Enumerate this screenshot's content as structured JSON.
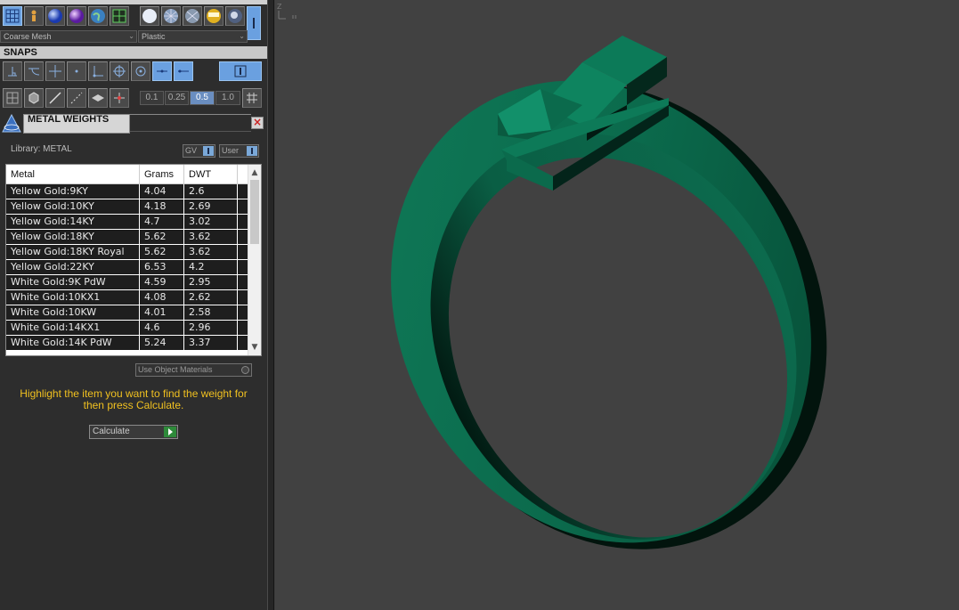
{
  "toolbar": {
    "mesh_dropdown": "Coarse Mesh",
    "material_dropdown": "Plastic"
  },
  "snaps": {
    "title": "SNAPS",
    "values": [
      "0.1",
      "0.25",
      "0.5",
      "1.0"
    ],
    "selected_value": "0.5"
  },
  "metal_weights": {
    "title": "METAL WEIGHTS",
    "library_label": "Library: METAL",
    "toggle_gv": "GV",
    "toggle_user": "User",
    "columns": [
      "Metal",
      "Grams",
      "DWT"
    ],
    "rows": [
      {
        "metal": "Yellow Gold:9KY",
        "grams": "4.04",
        "dwt": "2.6"
      },
      {
        "metal": "Yellow Gold:10KY",
        "grams": "4.18",
        "dwt": "2.69"
      },
      {
        "metal": "Yellow Gold:14KY",
        "grams": "4.7",
        "dwt": "3.02"
      },
      {
        "metal": "Yellow Gold:18KY",
        "grams": "5.62",
        "dwt": "3.62"
      },
      {
        "metal": "Yellow Gold:18KY Royal",
        "grams": "5.62",
        "dwt": "3.62"
      },
      {
        "metal": "Yellow Gold:22KY",
        "grams": "6.53",
        "dwt": "4.2"
      },
      {
        "metal": "White Gold:9K PdW",
        "grams": "4.59",
        "dwt": "2.95"
      },
      {
        "metal": "White Gold:10KX1",
        "grams": "4.08",
        "dwt": "2.62"
      },
      {
        "metal": "White Gold:10KW",
        "grams": "4.01",
        "dwt": "2.58"
      },
      {
        "metal": "White Gold:14KX1",
        "grams": "4.6",
        "dwt": "2.96"
      },
      {
        "metal": "White Gold:14K PdW",
        "grams": "5.24",
        "dwt": "3.37"
      }
    ],
    "use_object_materials": "Use Object Materials",
    "hint": "Highlight the item you want to find the weight for then press Calculate.",
    "calculate_label": "Calculate"
  },
  "colors": {
    "panel_bg": "#2d2d2d",
    "viewport_bg": "#414141",
    "ring_color": "#0d6b4f",
    "hint_color": "#f0c020",
    "accent_blue": "#6aa0e0"
  },
  "icons": {
    "top_row": [
      "grid-icon",
      "figure-icon",
      "blue-sphere-icon",
      "purple-sphere-icon",
      "globe-icon",
      "green-grid-icon"
    ],
    "render_row": [
      "white-sphere-icon",
      "wire-sphere-icon",
      "wire-sphere-alt-icon",
      "gold-sphere-icon",
      "chrome-sphere-icon"
    ],
    "snap_row": [
      "snap-perpendicular-icon",
      "snap-tangent-icon",
      "snap-intersection-icon",
      "snap-point-icon",
      "snap-corner-icon",
      "snap-center-icon",
      "snap-circle-icon",
      "snap-midpoint-icon",
      "snap-end-icon"
    ],
    "snap_row2": [
      "snap-grid-icon",
      "snap-box-icon",
      "snap-line-icon",
      "snap-dotted-icon",
      "snap-plane-icon",
      "snap-vertex-icon"
    ]
  }
}
